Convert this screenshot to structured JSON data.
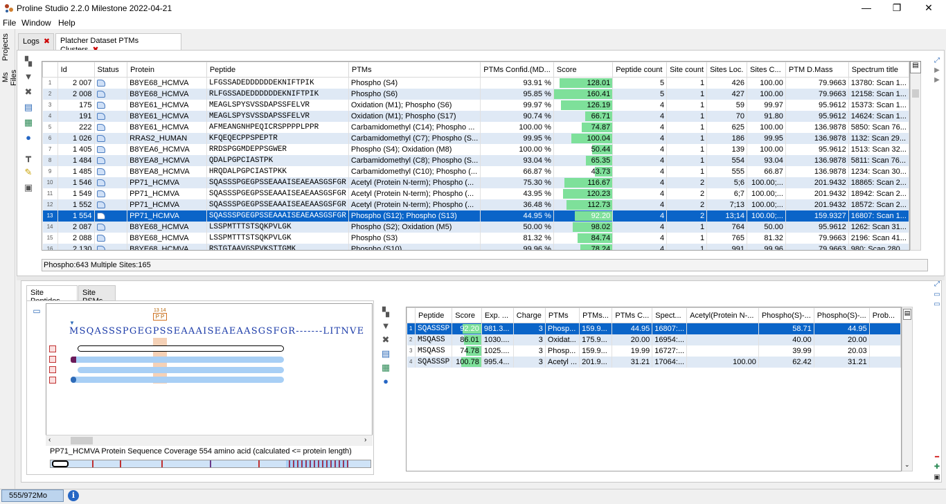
{
  "window": {
    "title": "Proline Studio 2.2.0 Milestone 2022-04-21",
    "min": "—",
    "max": "❐",
    "close": "✕"
  },
  "menu": [
    "File",
    "Window",
    "Help"
  ],
  "sidebar_tabs": [
    "Projects",
    "Ms Files"
  ],
  "tabs": [
    {
      "label": "Logs"
    },
    {
      "label": "Platcher Dataset PTMs Clusters"
    }
  ],
  "close_glyph": "✖",
  "clusters": {
    "columns": [
      "",
      "Id",
      "Status",
      "Protein",
      "Peptide",
      "PTMs",
      "PTMs Confid.(MD...",
      "Score",
      "Peptide count",
      "Site count",
      "Sites Loc.",
      "Sites C...",
      "PTM D.Mass",
      "Spectrum title"
    ],
    "rows": [
      {
        "n": "1",
        "id": "2 007",
        "protein": "B8YE68_HCMVA",
        "peptide": "LFGSSADEDDDDDDEKNIFTPIK",
        "ptms": "Phospho (S4)",
        "conf": "93.91 %",
        "score": "128.01",
        "scoreFrac": 0.9,
        "pc": "5",
        "sc": "1",
        "loc": "426",
        "sitesc": "100.00",
        "mass": "79.9663",
        "spec": "13780: Scan 1..."
      },
      {
        "n": "2",
        "id": "2 008",
        "protein": "B8YE68_HCMVA",
        "peptide": "RLFGSSADEDDDDDDEKNIFTPIK",
        "ptms": "Phospho (S6)",
        "conf": "95.85 %",
        "score": "160.41",
        "scoreFrac": 1.0,
        "pc": "5",
        "sc": "1",
        "loc": "427",
        "sitesc": "100.00",
        "mass": "79.9663",
        "spec": "12158: Scan 1..."
      },
      {
        "n": "3",
        "id": "175",
        "protein": "B8YE61_HCMVA",
        "peptide": "MEAGLSPYSVSSDAPSSFELVR",
        "ptms": "Oxidation (M1); Phospho (S6)",
        "conf": "99.97 %",
        "score": "126.19",
        "scoreFrac": 0.88,
        "pc": "4",
        "sc": "1",
        "loc": "59",
        "sitesc": "99.97",
        "mass": "95.9612",
        "spec": "15373: Scan 1..."
      },
      {
        "n": "4",
        "id": "191",
        "protein": "B8YE61_HCMVA",
        "peptide": "MEAGLSPYSVSSDAPSSFELVR",
        "ptms": "Oxidation (M1); Phospho (S17)",
        "conf": "90.74 %",
        "score": "66.71",
        "scoreFrac": 0.46,
        "pc": "4",
        "sc": "1",
        "loc": "70",
        "sitesc": "91.80",
        "mass": "95.9612",
        "spec": "14624: Scan 1..."
      },
      {
        "n": "5",
        "id": "222",
        "protein": "B8YE61_HCMVA",
        "peptide": "AFMEANGNHPEQICRSPPPPLPPR",
        "ptms": "Carbamidomethyl (C14); Phospho ...",
        "conf": "100.00 %",
        "score": "74.87",
        "scoreFrac": 0.52,
        "pc": "4",
        "sc": "1",
        "loc": "625",
        "sitesc": "100.00",
        "mass": "136.9878",
        "spec": "5850: Scan 76..."
      },
      {
        "n": "6",
        "id": "1 026",
        "protein": "RRAS2_HUMAN",
        "peptide": "KFQEQECPPSPEPTR",
        "ptms": "Carbamidomethyl (C7); Phospho (S...",
        "conf": "99.95 %",
        "score": "100.04",
        "scoreFrac": 0.7,
        "pc": "4",
        "sc": "1",
        "loc": "186",
        "sitesc": "99.95",
        "mass": "136.9878",
        "spec": "1132: Scan 29..."
      },
      {
        "n": "7",
        "id": "1 405",
        "protein": "B8YEA6_HCMVA",
        "peptide": "RRDSPGGMDEPPSGWER",
        "ptms": "Phospho (S4); Oxidation (M8)",
        "conf": "100.00 %",
        "score": "50.44",
        "scoreFrac": 0.35,
        "pc": "4",
        "sc": "1",
        "loc": "139",
        "sitesc": "100.00",
        "mass": "95.9612",
        "spec": "1513: Scan 32..."
      },
      {
        "n": "8",
        "id": "1 484",
        "protein": "B8YEA8_HCMVA",
        "peptide": "QDALPGPCIASTPK",
        "ptms": "Carbamidomethyl (C8); Phospho (S...",
        "conf": "93.04 %",
        "score": "65.35",
        "scoreFrac": 0.45,
        "pc": "4",
        "sc": "1",
        "loc": "554",
        "sitesc": "93.04",
        "mass": "136.9878",
        "spec": "5811: Scan 76..."
      },
      {
        "n": "9",
        "id": "1 485",
        "protein": "B8YEA8_HCMVA",
        "peptide": "HRQDALPGPCIASTPKK",
        "ptms": "Carbamidomethyl (C10); Phospho (...",
        "conf": "66.87 %",
        "score": "43.73",
        "scoreFrac": 0.3,
        "pc": "4",
        "sc": "1",
        "loc": "555",
        "sitesc": "66.87",
        "mass": "136.9878",
        "spec": "1234: Scan 30..."
      },
      {
        "n": "10",
        "id": "1 546",
        "protein": "PP71_HCMVA",
        "peptide": "SQASSSPGEGPSSEAAAISEAEAASGSFGR",
        "ptms": "Acetyl (Protein N-term); Phospho (...",
        "conf": "75.30 %",
        "score": "116.67",
        "scoreFrac": 0.82,
        "pc": "4",
        "sc": "2",
        "loc": "5;6",
        "sitesc": "100.00;...",
        "mass": "201.9432",
        "spec": "18865: Scan 2..."
      },
      {
        "n": "11",
        "id": "1 549",
        "protein": "PP71_HCMVA",
        "peptide": "SQASSSPGEGPSSEAAAISEAEAASGSFGR",
        "ptms": "Acetyl (Protein N-term); Phospho (...",
        "conf": "43.95 %",
        "score": "120.23",
        "scoreFrac": 0.84,
        "pc": "4",
        "sc": "2",
        "loc": "6;7",
        "sitesc": "100.00;...",
        "mass": "201.9432",
        "spec": "18942: Scan 2..."
      },
      {
        "n": "12",
        "id": "1 552",
        "protein": "PP71_HCMVA",
        "peptide": "SQASSSPGEGPSSEAAAISEAEAASGSFGR",
        "ptms": "Acetyl (Protein N-term); Phospho (...",
        "conf": "36.48 %",
        "score": "112.73",
        "scoreFrac": 0.79,
        "pc": "4",
        "sc": "2",
        "loc": "7;13",
        "sitesc": "100.00;...",
        "mass": "201.9432",
        "spec": "18572: Scan 2..."
      },
      {
        "n": "13",
        "id": "1 554",
        "protein": "PP71_HCMVA",
        "peptide": "SQASSSPGEGPSSEAAAISEAEAASGSFGR",
        "ptms": "Phospho (S12); Phospho (S13)",
        "conf": "44.95 %",
        "score": "92.20",
        "scoreFrac": 0.64,
        "pc": "4",
        "sc": "2",
        "loc": "13;14",
        "sitesc": "100.00;...",
        "mass": "159.9327",
        "spec": "16807: Scan 1...",
        "selected": true
      },
      {
        "n": "14",
        "id": "2 087",
        "protein": "B8YE68_HCMVA",
        "peptide": "LSSPMTTTSTSQKPVLGK",
        "ptms": "Phospho (S2); Oxidation (M5)",
        "conf": "50.00 %",
        "score": "98.02",
        "scoreFrac": 0.68,
        "pc": "4",
        "sc": "1",
        "loc": "764",
        "sitesc": "50.00",
        "mass": "95.9612",
        "spec": "1262: Scan 31..."
      },
      {
        "n": "15",
        "id": "2 088",
        "protein": "B8YE68_HCMVA",
        "peptide": "LSSPMTTTSTSQKPVLGK",
        "ptms": "Phospho (S3)",
        "conf": "81.32 %",
        "score": "84.74",
        "scoreFrac": 0.59,
        "pc": "4",
        "sc": "1",
        "loc": "765",
        "sitesc": "81.32",
        "mass": "79.9663",
        "spec": "2196: Scan 41..."
      },
      {
        "n": "16",
        "id": "2 130",
        "protein": "B8YE68_HCMVA",
        "peptide": "RSTGTAAVGSPVKSTTGMK",
        "ptms": "Phospho (S10)",
        "conf": "99.96 %",
        "score": "78.24",
        "scoreFrac": 0.55,
        "pc": "4",
        "sc": "1",
        "loc": "991",
        "sitesc": "99.96",
        "mass": "79.9663",
        "spec": "980: Scan 280..."
      }
    ]
  },
  "status_line": "Phospho:643  Multiple Sites:165",
  "bottom_tabs": [
    "Site Peptides",
    "Site PSMs"
  ],
  "sequence": {
    "text": "MSQASSSPGEGPSSEAAAISEAEAASGSFGR-------LITNVE",
    "site_labels": "13 14",
    "site_marks": "P P",
    "coverage_label": "PP71_HCMVA Protein Sequence Coverage 554 amino acid (calculated <= protein length)"
  },
  "psms": {
    "columns": [
      "",
      "Peptide",
      "Score",
      "Exp. ...",
      "Charge",
      "PTMs",
      "PTMs...",
      "PTMs C...",
      "Spect...",
      "Acetyl(Protein N-...",
      "Phospho(S)-...",
      "Phospho(S)-...",
      "Prob..."
    ],
    "rows": [
      {
        "n": "1",
        "pep": "SQASSSP",
        "score": "92.20",
        "frac": 0.64,
        "exp": "981.3...",
        "charge": "3",
        "ptms": "Phosp...",
        "ptms2": "159.9...",
        "ptmsc": "44.95",
        "spec": "16807:...",
        "acetyl": "",
        "ph1": "58.71",
        "ph2": "44.95",
        "selected": true
      },
      {
        "n": "2",
        "pep": "MSQASS",
        "score": "86.01",
        "frac": 0.6,
        "exp": "1030....",
        "charge": "3",
        "ptms": "Oxidat...",
        "ptms2": "175.9...",
        "ptmsc": "20.00",
        "spec": "16954:...",
        "acetyl": "",
        "ph1": "40.00",
        "ph2": "20.00"
      },
      {
        "n": "3",
        "pep": "MSQASS",
        "score": "74.78",
        "frac": 0.52,
        "exp": "1025....",
        "charge": "3",
        "ptms": "Phosp...",
        "ptms2": "159.9...",
        "ptmsc": "19.99",
        "spec": "16727:...",
        "acetyl": "",
        "ph1": "39.99",
        "ph2": "20.03"
      },
      {
        "n": "4",
        "pep": "SQASSSP",
        "score": "100.78",
        "frac": 0.7,
        "exp": "995.4...",
        "charge": "3",
        "ptms": "Acetyl ...",
        "ptms2": "201.9...",
        "ptmsc": "31.21",
        "spec": "17064:...",
        "acetyl": "100.00",
        "ph1": "62.42",
        "ph2": "31.21"
      }
    ]
  },
  "memory": "555/972Mo",
  "info_glyph": "i",
  "colors": {
    "selection": "#0a64c8",
    "score_bar": "#7ee09a",
    "alt_row": "#dfe9f5",
    "highlight": "#f0c080"
  }
}
